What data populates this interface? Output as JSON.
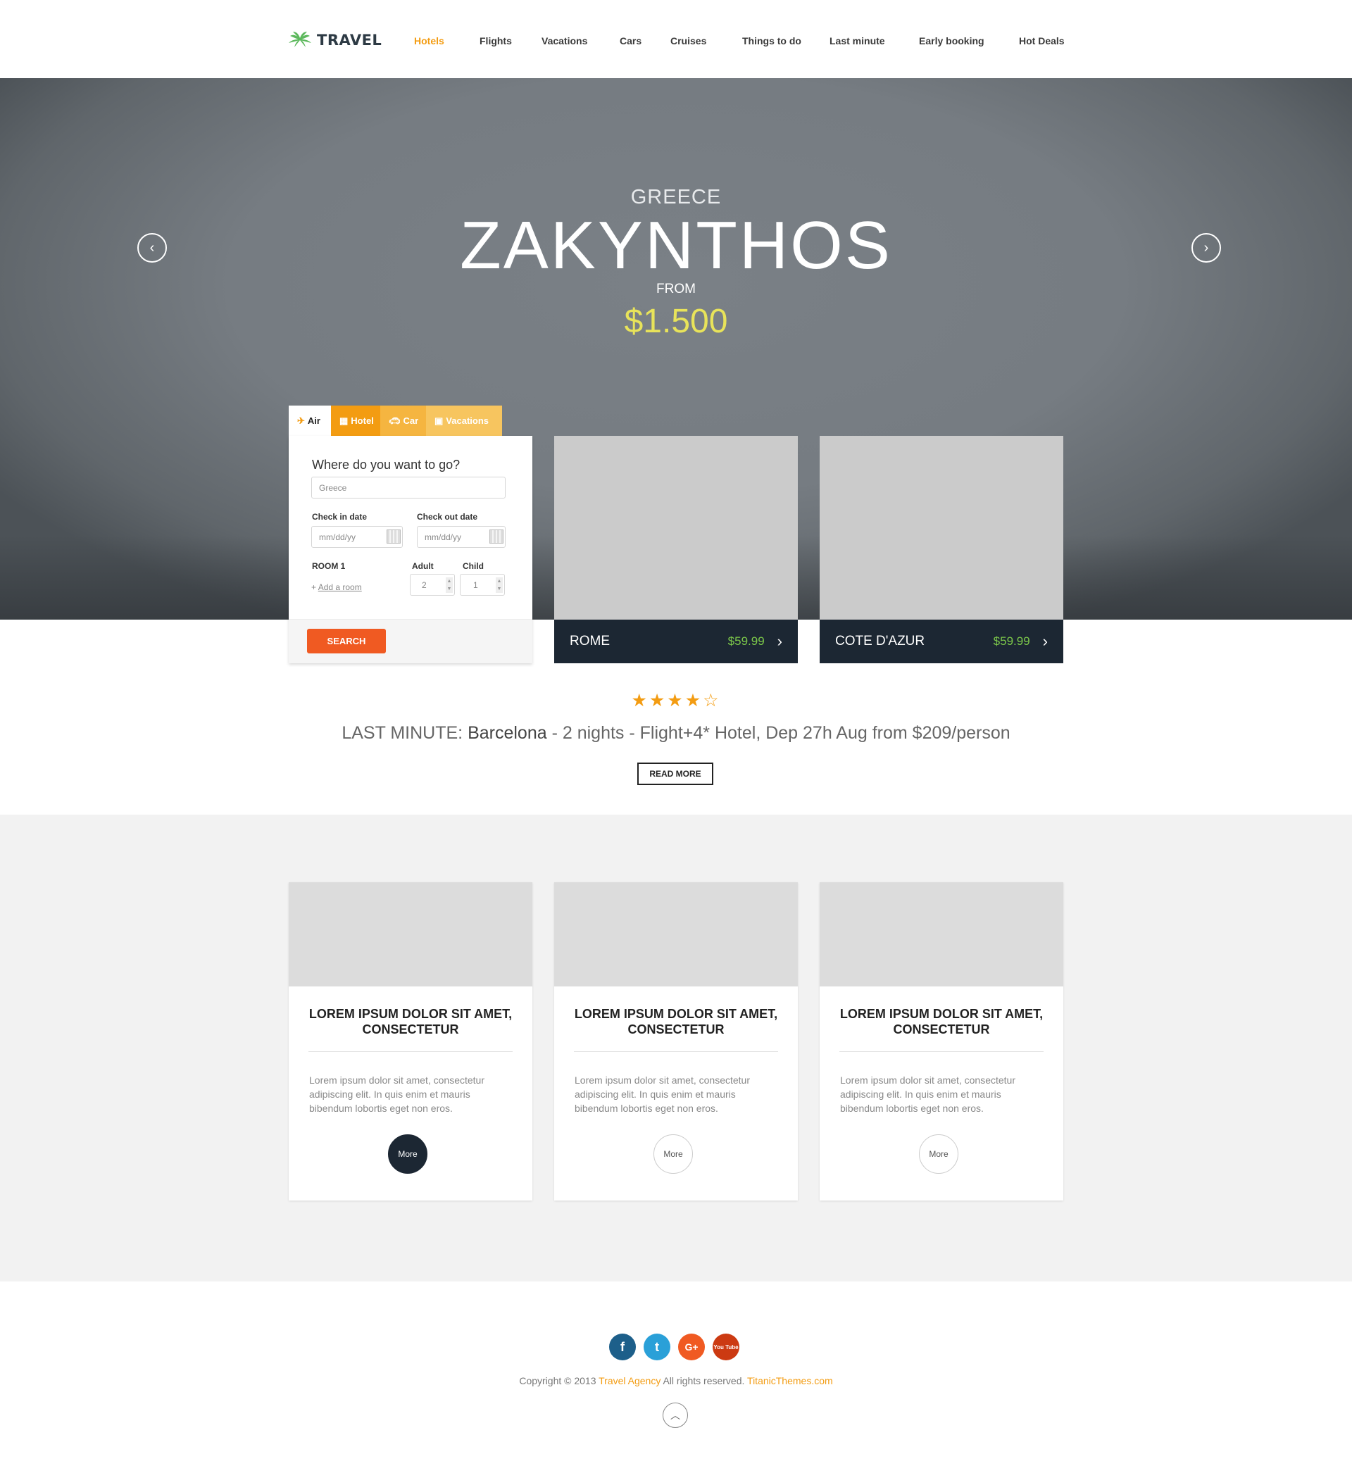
{
  "brand": {
    "name": "TRAVEL",
    "logo_color": "#5cb85c"
  },
  "nav": [
    {
      "label": "Hotels",
      "active": true
    },
    {
      "label": "Flights"
    },
    {
      "label": "Vacations"
    },
    {
      "label": "Cars"
    },
    {
      "label": "Cruises"
    },
    {
      "label": "Things to do"
    },
    {
      "label": "Last minute"
    },
    {
      "label": "Early booking"
    },
    {
      "label": "Hot Deals"
    }
  ],
  "hero": {
    "country": "GREECE",
    "title": "ZAKYNTHOS",
    "from_label": "FROM",
    "price": "$1.500",
    "prev_icon": "chevron-left",
    "next_icon": "chevron-right"
  },
  "booking": {
    "tabs": [
      {
        "label": "Air",
        "icon": "plane"
      },
      {
        "label": "Hotel",
        "icon": "building"
      },
      {
        "label": "Car",
        "icon": "car"
      },
      {
        "label": "Vacations",
        "icon": "suitcase"
      }
    ],
    "question": "Where do you want to go?",
    "destination_value": "Greece",
    "checkin_label": "Check in date",
    "checkout_label": "Check out date",
    "date_placeholder": "mm/dd/yy",
    "room_label": "ROOM 1",
    "adult_label": "Adult",
    "child_label": "Child",
    "adult_value": "2",
    "child_value": "1",
    "add_room_prefix": "+",
    "add_room": "Add a room",
    "search_label": "SEARCH"
  },
  "destinations": [
    {
      "name": "ROME",
      "price": "$59.99"
    },
    {
      "name": "COTE D'AZUR",
      "price": "$59.99"
    }
  ],
  "last_minute": {
    "stars": "★★★★☆",
    "prefix": "LAST MINUTE:",
    "place": "Barcelona",
    "details": "- 2 nights - Flight+4* Hotel, Dep 27h Aug from $209/person",
    "button": "READ MORE"
  },
  "cards": [
    {
      "title": "LOREM IPSUM DOLOR SIT AMET, CONSECTETUR",
      "text": "Lorem ipsum dolor sit amet, consectetur adipiscing elit. In quis enim et mauris bibendum lobortis eget non eros.",
      "button": "More"
    },
    {
      "title": "LOREM IPSUM DOLOR SIT AMET, CONSECTETUR",
      "text": "Lorem ipsum dolor sit amet, consectetur adipiscing elit. In quis enim et mauris bibendum lobortis eget non eros.",
      "button": "More"
    },
    {
      "title": "LOREM IPSUM DOLOR SIT AMET, CONSECTETUR",
      "text": "Lorem ipsum dolor sit amet, consectetur adipiscing elit. In quis enim et mauris bibendum lobortis eget non eros.",
      "button": "More"
    }
  ],
  "footer": {
    "social": [
      {
        "name": "facebook",
        "glyph": "f",
        "color": "#1d5f8a"
      },
      {
        "name": "twitter",
        "glyph": "t",
        "color": "#2aa0d8"
      },
      {
        "name": "google-plus",
        "glyph": "G+",
        "color": "#f05a22"
      },
      {
        "name": "youtube",
        "glyph": "You Tube",
        "color": "#cc3a12"
      }
    ],
    "copyright_prefix": "Copyright © 2013",
    "agency": "Travel Agency",
    "rights": "All rights reserved.",
    "site": "TitanicThemes.com",
    "totop_icon": "chevron-up"
  }
}
